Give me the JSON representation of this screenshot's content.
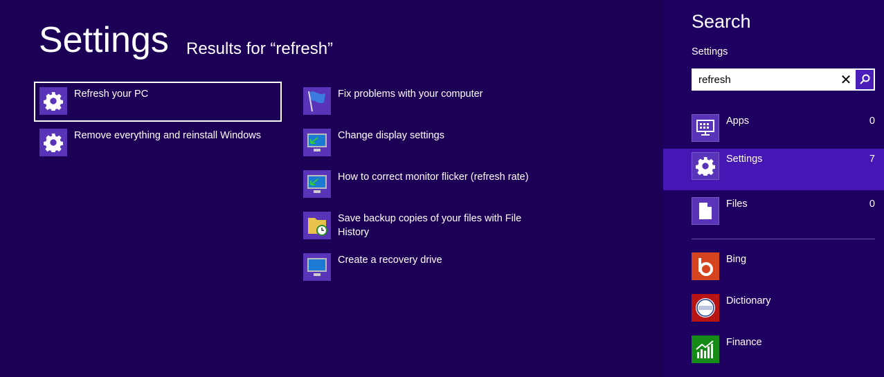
{
  "main": {
    "title": "Settings",
    "subtitle": "Results for “refresh”",
    "results_left": [
      {
        "label": "Refresh your PC",
        "icon": "gear-icon",
        "selected": true
      },
      {
        "label": "Remove everything and reinstall Windows",
        "icon": "gear-icon"
      }
    ],
    "results_right": [
      {
        "label": "Fix problems with your computer",
        "icon": "flag-icon"
      },
      {
        "label": "Change display settings",
        "icon": "monitor-icon"
      },
      {
        "label": "How to correct monitor flicker (refresh rate)",
        "icon": "monitor-icon"
      },
      {
        "label": "Save backup copies of your files with File History",
        "icon": "folder-clock-icon"
      },
      {
        "label": "Create a recovery drive",
        "icon": "monitor-icon"
      }
    ]
  },
  "panel": {
    "title": "Search",
    "scope": "Settings",
    "search_value": "refresh",
    "categories": [
      {
        "label": "Apps",
        "count": "0"
      },
      {
        "label": "Settings",
        "count": "7",
        "active": true
      },
      {
        "label": "Files",
        "count": "0"
      }
    ],
    "apps": [
      {
        "label": "Bing",
        "color": "#d6431f"
      },
      {
        "label": "Dictionary",
        "color": "#b81414"
      },
      {
        "label": "Finance",
        "color": "#168a16"
      }
    ]
  },
  "colors": {
    "background": "#1b0055",
    "panel": "#1e0060",
    "highlight": "#4617b4",
    "tile": "#5a34b8"
  }
}
